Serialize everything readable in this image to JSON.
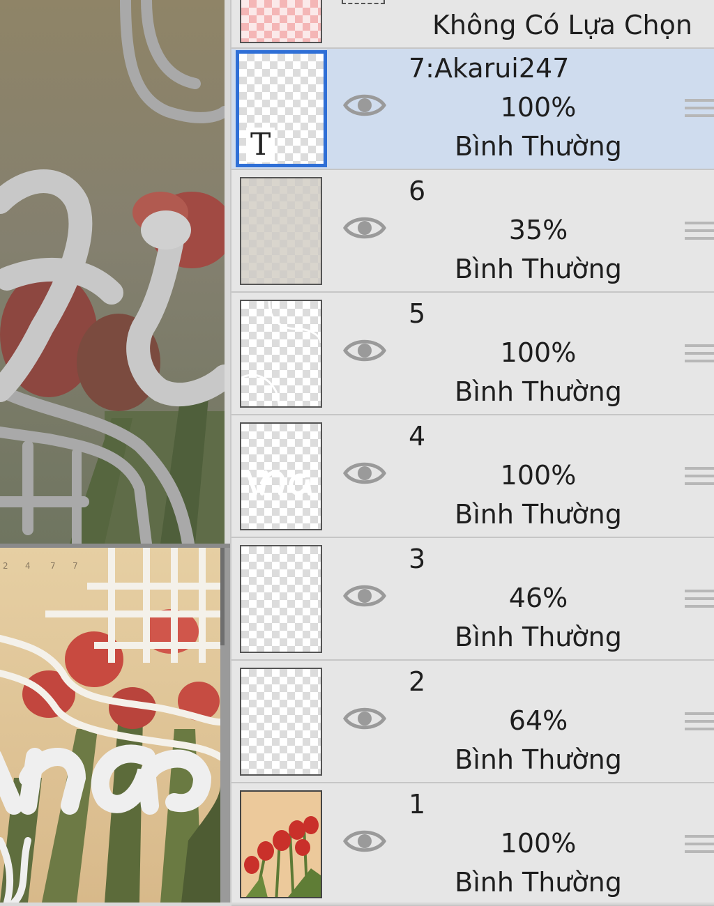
{
  "selection_row": {
    "label": "Không Có Lựa Chọn"
  },
  "layers": [
    {
      "name": "7:Akarui247",
      "opacity": "100%",
      "blend": "Bình Thường",
      "selected": true,
      "thumb": "text"
    },
    {
      "name": "6",
      "opacity": "35%",
      "blend": "Bình Thường",
      "selected": false,
      "thumb": "tint"
    },
    {
      "name": "5",
      "opacity": "100%",
      "blend": "Bình Thường",
      "selected": false,
      "thumb": "transparent"
    },
    {
      "name": "4",
      "opacity": "100%",
      "blend": "Bình Thường",
      "selected": false,
      "thumb": "transparent"
    },
    {
      "name": "3",
      "opacity": "46%",
      "blend": "Bình Thường",
      "selected": false,
      "thumb": "transparent"
    },
    {
      "name": "2",
      "opacity": "64%",
      "blend": "Bình Thường",
      "selected": false,
      "thumb": "transparent"
    },
    {
      "name": "1",
      "opacity": "100%",
      "blend": "Bình Thường",
      "selected": false,
      "thumb": "photo"
    }
  ],
  "icons": {
    "visibility": "eye-icon",
    "drag": "drag-handle-icon",
    "text_layer": "text-layer-icon"
  },
  "colors": {
    "selected_row": "#cfdcee",
    "selected_border": "#2f6fd6",
    "panel_bg": "#e6e6e6"
  }
}
